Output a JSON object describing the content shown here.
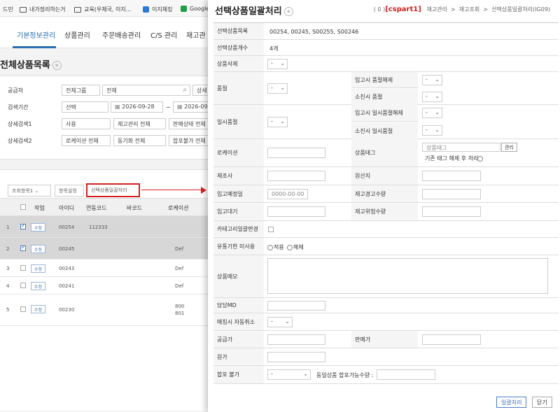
{
  "bookmarks": [
    "드민",
    "내가정리하는거",
    "교육(우체국, 이지...",
    "이지체킹",
    "Google"
  ],
  "nav": {
    "tabs": [
      "기본정보관리",
      "상품관리",
      "주문배송관리",
      "C/S 관리",
      "재고관"
    ],
    "active": 0
  },
  "page": {
    "title": "전체상품목록"
  },
  "search": {
    "supplier_label": "공급처",
    "supplier_group": "전체그룹",
    "supplier_value": "전체",
    "supplier_btn": "상세",
    "period_label": "검색기간",
    "period_select": "선택",
    "date_from": "2026-09-28",
    "tilde": "~",
    "date_to": "2026-09",
    "detail1_label": "상세검색1",
    "d1_a": "사용",
    "d1_b": "재고관리 전체",
    "d1_c": "판매상태 전체",
    "detail2_label": "상세검색2",
    "d2_a": "로케이션 전체",
    "d2_b": "동기화 전체",
    "d2_c": "합포불가 전체"
  },
  "grid": {
    "view_items": "조회항목1",
    "col_setting": "항목설정",
    "batch_button": "선택상품일괄처리",
    "headers": [
      "작업",
      "아이디",
      "연동코드",
      "바코드",
      "로케이션"
    ],
    "edit_label": "수정",
    "rows": [
      {
        "no": "1",
        "checked": true,
        "id": "00254",
        "link": "112333",
        "barcode": "",
        "loc": ""
      },
      {
        "no": "2",
        "checked": true,
        "id": "00245",
        "link": "",
        "barcode": "",
        "loc": "Def"
      },
      {
        "no": "3",
        "checked": false,
        "id": "00243",
        "link": "",
        "barcode": "",
        "loc": "Def"
      },
      {
        "no": "4",
        "checked": false,
        "id": "00241",
        "link": "",
        "barcode": "",
        "loc": "Def"
      },
      {
        "no": "5",
        "checked": false,
        "id": "00230",
        "link": "",
        "barcode": "",
        "loc": "800\n801"
      }
    ]
  },
  "modal": {
    "title": "선택상품일괄처리",
    "crumb_count": "( 0 )",
    "crumb_tag": "[cspart1]",
    "crumb_1": "재고관리",
    "crumb_2": "재고조회",
    "crumb_3": "선택상품일괄처리(IG09)",
    "sep": ">",
    "f_list_label": "선택상품목록",
    "f_list_value": "00254, 00245, S00255, S00246",
    "f_count_label": "선택상품개수",
    "f_count_value": "4개",
    "f_delete_label": "상품삭제",
    "dash": "-",
    "f_soldout_label": "품절",
    "f_in_release_label": "입고시 품절해제",
    "f_out_soldout_label": "소진시 품절",
    "f_temp_label": "일시품절",
    "f_in_temp_release_label": "입고시 일시품절해제",
    "f_out_temp_label": "소진시 일시품절",
    "f_location_label": "로케이션",
    "f_tag_label": "상품태그",
    "f_tag_placeholder": "상품태그",
    "f_tag_btn": "관리",
    "f_tag_clear": "기존 태그 해제 후 처리",
    "f_maker_label": "제조사",
    "f_origin_label": "원산지",
    "f_indate_label": "입고예정일",
    "f_indate_placeholder": "0000-00-00",
    "f_warn_label": "재고경고수량",
    "f_wait_label": "입고대기",
    "f_danger_label": "재고위험수량",
    "f_category_label": "카테고리일괄변경",
    "f_expiry_label": "유통기한 미사용",
    "f_apply": "적용",
    "f_release": "해제",
    "f_memo_label": "상품메모",
    "f_md_label": "담당MD",
    "f_auto_cancel_label": "매칭시 자동취소",
    "f_supply_price_label": "공급가",
    "f_sale_price_label": "판매가",
    "f_cost_label": "원가",
    "f_merge_label": "합포 불가",
    "f_merge_qty_label": "동일상품 합포가능수량 :",
    "apply_button": "일괄처리",
    "close_button": "닫기"
  }
}
